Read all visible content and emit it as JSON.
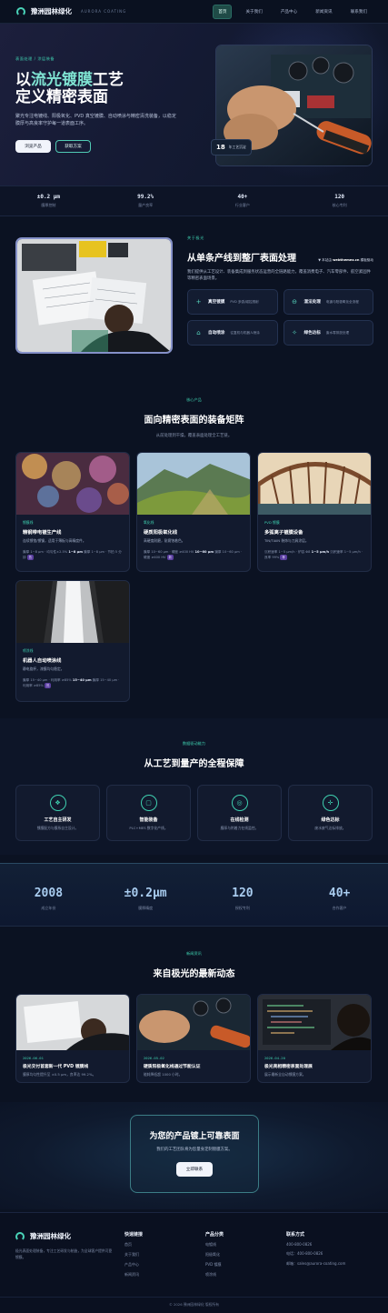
{
  "nav": {
    "brand": "豫洲园林绿化",
    "brand_sub": "AURORA COATING",
    "links": [
      "首页",
      "关于我们",
      "产品中心",
      "新闻资讯",
      "联系我们"
    ]
  },
  "hero": {
    "eyebrow": "表面处理 / 涂层装备",
    "title_line1_pre": "以",
    "title_line1_hl": "流光镀膜",
    "title_line1_post": "工艺",
    "title_line2": "定义精密表面",
    "desc": "聚光专注电镀线、阳极氧化、PVD 真空镀膜、自动喷涂与精密清洗装备，以稳定膜厚与高良率守护每一道表面工序。",
    "btn_primary": "浏览产品",
    "btn_secondary": "获取方案",
    "badge_number": "18",
    "badge_text": "年工艺沉淀"
  },
  "stats_top": [
    {
      "value": "±0.2 μm",
      "label": "膜厚控制"
    },
    {
      "value": "99.2%",
      "label": "量产良率"
    },
    {
      "value": "40+",
      "label": "行业客户"
    },
    {
      "value": "120",
      "label": "核心专利"
    }
  ],
  "about": {
    "eyebrow": "关于极光",
    "title": "从单条产线到整厂表面处理",
    "source_prefix": "▼ 本站由",
    "source_site": "webthemez.cn",
    "source_suffix": "模板驱动",
    "desc": "我们提供从工艺设计、装备集成到服务状态运营的全链路能力，覆盖消费电子、汽车零部件、航空紧固件等精密表面场景。",
    "features": [
      {
        "icon": "plus-icon",
        "glyph": "+",
        "title": "真空镀膜",
        "desc": "PVD 多弧/磁控溅射"
      },
      {
        "icon": "minus-circle-icon",
        "glyph": "⊖",
        "title": "湿法处理",
        "desc": "电镀与阳极氧化全流程"
      },
      {
        "icon": "home-icon",
        "glyph": "⌂",
        "title": "自动喷涂",
        "desc": "往复机与机器人喷涂"
      },
      {
        "icon": "sparkle-icon",
        "glyph": "✧",
        "title": "绿色达标",
        "desc": "废水零排放处理"
      }
    ]
  },
  "equipment": {
    "eyebrow": "核心产品",
    "title": "面向精密表面的装备矩阵",
    "subtitle": "从前处理到干燥，覆盖表面处理全工艺链。",
    "cards": [
      {
        "tag": "镀膜线",
        "title": "精钢带电镀生产线",
        "desc": "连续镀铬/镀镍，适用于薄板与高精度件。",
        "spec_a": "膜厚 1~8 μm · 均匀性±2.5%",
        "spec_b": "1~8 μm",
        "spec_c": "膜厚 1~8 μm · 节拍 5 分钟",
        "pill": "热"
      },
      {
        "tag": "氧化线",
        "title": "硬质阳极氧化线",
        "desc": "高硬度耐磨，耐腐蚀着色。",
        "spec_a": "膜厚 10~60 μm · 硬度 ≥400 HV",
        "spec_b": "10~60 μm",
        "spec_c": "膜厚 10~60 μm · 硬度 ≥400 HV",
        "pill": "新"
      },
      {
        "tag": "PVD 镀膜",
        "title": "多弧离子镀膜设备",
        "desc": "TiN/TiAlN 装饰与刀具涂层。",
        "spec_a": "沉积速率 1~5 μm/h · 炉容 Φ8",
        "spec_b": "1~5 μm/h",
        "spec_c": "沉积速率 1~5 μm/h · 良率 99%",
        "pill": "荐"
      },
      {
        "tag": "喷涂线",
        "title": "机器人自动喷涂线",
        "desc": "静电旋杯，漆膜均匀稳定。",
        "spec_a": "膜厚 15~40 μm · 利用率 ≥85%",
        "spec_b": "15~40 μm",
        "spec_c": "膜厚 15~40 μm · 利用率 ≥85%",
        "pill": "热"
      }
    ]
  },
  "assurance": {
    "eyebrow": "数据驱动能力",
    "title": "从工艺到量产的全程保障",
    "items": [
      {
        "icon": "layers-icon",
        "glyph": "❖",
        "title": "工艺自主研发",
        "desc": "镀膜配方与膜系自主设计。"
      },
      {
        "icon": "document-icon",
        "glyph": "▢",
        "title": "智能装备",
        "desc": "PLC+MES 数字化产线。"
      },
      {
        "icon": "target-icon",
        "glyph": "◎",
        "title": "在线检测",
        "desc": "膜厚与附着力在线监控。"
      },
      {
        "icon": "crosshair-icon",
        "glyph": "✛",
        "title": "绿色达标",
        "desc": "废水废气达标排放。"
      }
    ]
  },
  "stats_bottom": [
    {
      "value": "2008",
      "label": "成立年份"
    },
    {
      "value": "±0.2μm",
      "label": "膜厚精度"
    },
    {
      "value": "120",
      "label": "授权专利"
    },
    {
      "value": "40+",
      "label": "合作客户"
    }
  ],
  "news": {
    "eyebrow": "新闻资讯",
    "title": "来自极光的最新动态",
    "items": [
      {
        "date": "2026-06-01",
        "title": "极光交付首套新一代 PVD 镀膜线",
        "desc": "膜厚均匀性提升至 ±0.5 μm，良率达 99.2%。"
      },
      {
        "date": "2026-05-02",
        "title": "硬质阳极氧化线通过节能认证",
        "desc": "能耗降低超 1000 小时。"
      },
      {
        "date": "2026-04-20",
        "title": "极光亮相精密表面处理展",
        "desc": "展示最新全自动镀膜方案。"
      }
    ]
  },
  "cta": {
    "title": "为您的产品镀上可靠表面",
    "desc": "我们的工艺团队将为您量身定制镀膜方案。",
    "button": "立即联系"
  },
  "footer": {
    "brand": "豫洲园林绿化",
    "desc": "极光表面处理装备，专注工艺研发与制造，为全球客户提供可靠镀膜。",
    "col1_title": "快速链接",
    "col1": [
      "首页",
      "关于我们",
      "产品中心",
      "新闻资讯"
    ],
    "col2_title": "产品分类",
    "col2": [
      "电镀线",
      "阳极氧化",
      "PVD 镀膜",
      "喷涂线"
    ],
    "col3_title": "联系方式",
    "col3": [
      "400-800-0826",
      "电话：400-800-0826",
      "邮箱：sales@aurora-coating.com"
    ],
    "copyright": "© 2026 豫洲园林绿化 版权所有"
  },
  "colors": {
    "accent": "#3fd0b0",
    "bg": "#0b1222",
    "card": "#121a2e"
  }
}
